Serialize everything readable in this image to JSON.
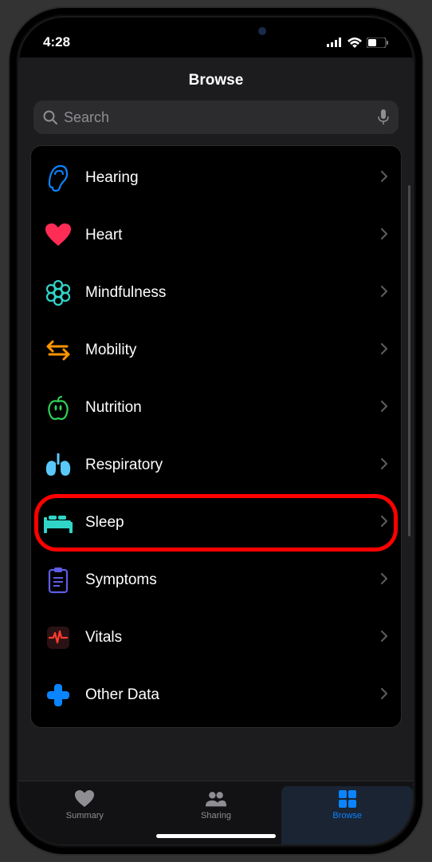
{
  "status": {
    "time": "4:28"
  },
  "header": {
    "title": "Browse"
  },
  "search": {
    "placeholder": "Search"
  },
  "categories": [
    {
      "id": "hearing",
      "label": "Hearing",
      "icon": "ear",
      "color": "#0a84ff"
    },
    {
      "id": "heart",
      "label": "Heart",
      "icon": "heart",
      "color": "#ff2d55"
    },
    {
      "id": "mindfulness",
      "label": "Mindfulness",
      "icon": "flower",
      "color": "#30d5c8"
    },
    {
      "id": "mobility",
      "label": "Mobility",
      "icon": "arrows",
      "color": "#ff9500"
    },
    {
      "id": "nutrition",
      "label": "Nutrition",
      "icon": "apple",
      "color": "#30d158"
    },
    {
      "id": "respiratory",
      "label": "Respiratory",
      "icon": "lungs",
      "color": "#5ac8fa"
    },
    {
      "id": "sleep",
      "label": "Sleep",
      "icon": "bed",
      "color": "#30d5c8",
      "highlight": true
    },
    {
      "id": "symptoms",
      "label": "Symptoms",
      "icon": "clipboard",
      "color": "#5e5ce6"
    },
    {
      "id": "vitals",
      "label": "Vitals",
      "icon": "ecg",
      "color": "#ff3b30"
    },
    {
      "id": "other",
      "label": "Other Data",
      "icon": "plus",
      "color": "#0a84ff"
    }
  ],
  "tabs": [
    {
      "id": "summary",
      "label": "Summary",
      "icon": "heart-fill",
      "active": false
    },
    {
      "id": "sharing",
      "label": "Sharing",
      "icon": "people",
      "active": false
    },
    {
      "id": "browse",
      "label": "Browse",
      "icon": "grid",
      "active": true
    }
  ]
}
